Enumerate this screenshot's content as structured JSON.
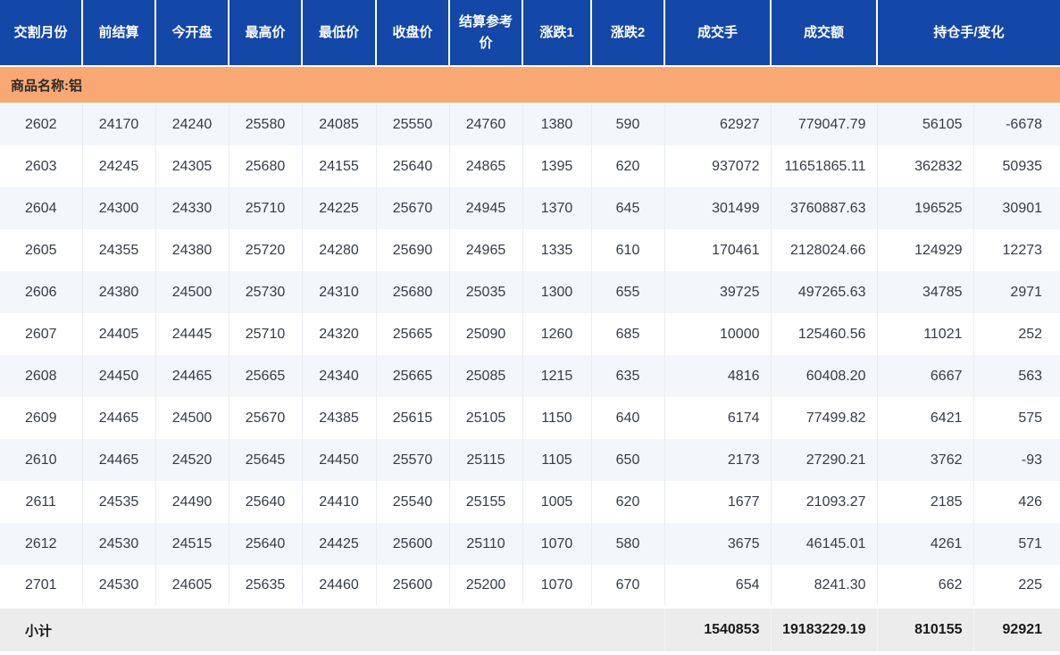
{
  "colors": {
    "header_bg": "#1347a8",
    "commodity_bg": "#f9a873",
    "row_alt_bg": "#f3f6fa",
    "subtotal_bg": "#ececec"
  },
  "table": {
    "headers": [
      "交割月份",
      "前结算",
      "今开盘",
      "最高价",
      "最低价",
      "收盘价",
      "结算参考价",
      "涨跌1",
      "涨跌2",
      "成交手",
      "成交额",
      "持仓手/变化"
    ],
    "commodity_label": "商品名称:铝",
    "rows": [
      [
        "2602",
        "24170",
        "24240",
        "25580",
        "24085",
        "25550",
        "24760",
        "1380",
        "590",
        "62927",
        "779047.79",
        "56105",
        "-6678"
      ],
      [
        "2603",
        "24245",
        "24305",
        "25680",
        "24155",
        "25640",
        "24865",
        "1395",
        "620",
        "937072",
        "11651865.11",
        "362832",
        "50935"
      ],
      [
        "2604",
        "24300",
        "24330",
        "25710",
        "24225",
        "25670",
        "24945",
        "1370",
        "645",
        "301499",
        "3760887.63",
        "196525",
        "30901"
      ],
      [
        "2605",
        "24355",
        "24380",
        "25720",
        "24280",
        "25690",
        "24965",
        "1335",
        "610",
        "170461",
        "2128024.66",
        "124929",
        "12273"
      ],
      [
        "2606",
        "24380",
        "24500",
        "25730",
        "24310",
        "25680",
        "25035",
        "1300",
        "655",
        "39725",
        "497265.63",
        "34785",
        "2971"
      ],
      [
        "2607",
        "24405",
        "24445",
        "25710",
        "24320",
        "25665",
        "25090",
        "1260",
        "685",
        "10000",
        "125460.56",
        "11021",
        "252"
      ],
      [
        "2608",
        "24450",
        "24465",
        "25665",
        "24340",
        "25665",
        "25085",
        "1215",
        "635",
        "4816",
        "60408.20",
        "6667",
        "563"
      ],
      [
        "2609",
        "24465",
        "24500",
        "25670",
        "24385",
        "25615",
        "25105",
        "1150",
        "640",
        "6174",
        "77499.82",
        "6421",
        "575"
      ],
      [
        "2610",
        "24465",
        "24520",
        "25645",
        "24450",
        "25570",
        "25115",
        "1105",
        "650",
        "2173",
        "27290.21",
        "3762",
        "-93"
      ],
      [
        "2611",
        "24535",
        "24490",
        "25640",
        "24410",
        "25540",
        "25155",
        "1005",
        "620",
        "1677",
        "21093.27",
        "2185",
        "426"
      ],
      [
        "2612",
        "24530",
        "24515",
        "25640",
        "24425",
        "25600",
        "25110",
        "1070",
        "580",
        "3675",
        "46145.01",
        "4261",
        "571"
      ],
      [
        "2701",
        "24530",
        "24605",
        "25635",
        "24460",
        "25600",
        "25200",
        "1070",
        "670",
        "654",
        "8241.30",
        "662",
        "225"
      ]
    ],
    "subtotal": {
      "label": "小计",
      "values": [
        "1540853",
        "19183229.19",
        "810155",
        "92921"
      ]
    }
  }
}
